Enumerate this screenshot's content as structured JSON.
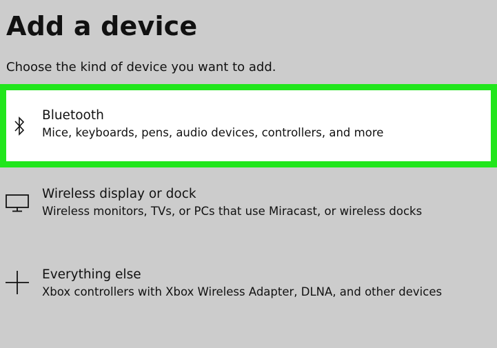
{
  "page": {
    "title": "Add a device",
    "subtitle": "Choose the kind of device you want to add."
  },
  "options": [
    {
      "title": "Bluetooth",
      "description": "Mice, keyboards, pens, audio devices, controllers, and more",
      "icon": "bluetooth-icon",
      "highlighted": true
    },
    {
      "title": "Wireless display or dock",
      "description": "Wireless monitors, TVs, or PCs that use Miracast, or wireless docks",
      "icon": "monitor-icon",
      "highlighted": false
    },
    {
      "title": "Everything else",
      "description": "Xbox controllers with Xbox Wireless Adapter, DLNA, and other devices",
      "icon": "plus-icon",
      "highlighted": false
    }
  ],
  "colors": {
    "background": "#cccccc",
    "highlight_border": "#21e61c",
    "highlight_fill": "#ffffff",
    "text": "#111111"
  }
}
